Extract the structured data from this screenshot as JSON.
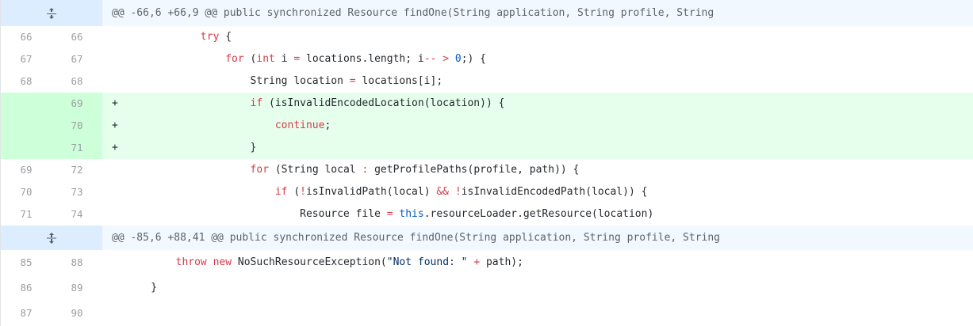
{
  "hunks": [
    {
      "header": "@@ -66,6 +66,9 @@ public synchronized Resource findOne(String application, String profile, String",
      "lines": [
        {
          "old": "66",
          "new": "66",
          "marker": "",
          "type": "ctx",
          "parts": [
            [
              "",
              "            "
            ],
            [
              "kw",
              "try"
            ],
            [
              "",
              " {"
            ]
          ]
        },
        {
          "old": "67",
          "new": "67",
          "marker": "",
          "type": "ctx",
          "parts": [
            [
              "",
              "                "
            ],
            [
              "kw",
              "for"
            ],
            [
              "",
              " ("
            ],
            [
              "kw",
              "int"
            ],
            [
              "",
              " i "
            ],
            [
              "op",
              "="
            ],
            [
              "",
              " locations.length; i"
            ],
            [
              "op",
              "--"
            ],
            [
              "",
              " "
            ],
            [
              "op",
              ">"
            ],
            [
              "",
              " "
            ],
            [
              "lit",
              "0"
            ],
            [
              "",
              ";) {"
            ]
          ]
        },
        {
          "old": "68",
          "new": "68",
          "marker": "",
          "type": "ctx",
          "parts": [
            [
              "",
              "                    String location "
            ],
            [
              "op",
              "="
            ],
            [
              "",
              " locations[i];"
            ]
          ]
        },
        {
          "old": "",
          "new": "69",
          "marker": "+",
          "type": "add",
          "parts": [
            [
              "",
              "                    "
            ],
            [
              "kw",
              "if"
            ],
            [
              "",
              " (isInvalidEncodedLocation(location)) {"
            ]
          ]
        },
        {
          "old": "",
          "new": "70",
          "marker": "+",
          "type": "add",
          "parts": [
            [
              "",
              "                        "
            ],
            [
              "kw",
              "continue"
            ],
            [
              "",
              ";"
            ]
          ]
        },
        {
          "old": "",
          "new": "71",
          "marker": "+",
          "type": "add",
          "parts": [
            [
              "",
              "                    }"
            ]
          ]
        },
        {
          "old": "69",
          "new": "72",
          "marker": "",
          "type": "ctx",
          "parts": [
            [
              "",
              "                    "
            ],
            [
              "kw",
              "for"
            ],
            [
              "",
              " (String local "
            ],
            [
              "op",
              ":"
            ],
            [
              "",
              " getProfilePaths(profile, path)) {"
            ]
          ]
        },
        {
          "old": "70",
          "new": "73",
          "marker": "",
          "type": "ctx",
          "parts": [
            [
              "",
              "                        "
            ],
            [
              "kw",
              "if"
            ],
            [
              "",
              " ("
            ],
            [
              "op",
              "!"
            ],
            [
              "",
              "isInvalidPath(local) "
            ],
            [
              "op",
              "&&"
            ],
            [
              "",
              " "
            ],
            [
              "op",
              "!"
            ],
            [
              "",
              "isInvalidEncodedPath(local)) {"
            ]
          ]
        },
        {
          "old": "71",
          "new": "74",
          "marker": "",
          "type": "ctx",
          "parts": [
            [
              "",
              "                            Resource file "
            ],
            [
              "op",
              "="
            ],
            [
              "",
              " "
            ],
            [
              "lit",
              "this"
            ],
            [
              "",
              ".resourceLoader.getResource(location)"
            ]
          ]
        }
      ]
    },
    {
      "header": "@@ -85,6 +88,41 @@ public synchronized Resource findOne(String application, String profile, String",
      "lines": [
        {
          "old": "85",
          "new": "88",
          "marker": "",
          "type": "ctx",
          "parts": [
            [
              "",
              "        "
            ],
            [
              "kw",
              "throw"
            ],
            [
              "",
              " "
            ],
            [
              "kw",
              "new"
            ],
            [
              "",
              " NoSuchResourceException("
            ],
            [
              "str",
              "\"Not found: \""
            ],
            [
              "",
              " "
            ],
            [
              "op",
              "+"
            ],
            [
              "",
              " path);"
            ]
          ]
        },
        {
          "old": "86",
          "new": "89",
          "marker": "",
          "type": "ctx",
          "parts": [
            [
              "",
              "    }"
            ]
          ]
        },
        {
          "old": "87",
          "new": "90",
          "marker": "",
          "type": "ctx",
          "parts": [
            [
              "",
              ""
            ]
          ]
        }
      ]
    }
  ],
  "icons": {
    "expand_up": "unfold-icon",
    "expand_both": "unfold-both-icon"
  },
  "colors": {
    "hunk_bg": "#f1f8ff",
    "hunk_expand_bg": "#dbedff",
    "add_bg": "#e6ffed",
    "add_num_bg": "#cdffd8",
    "keyword": "#d73a49"
  }
}
